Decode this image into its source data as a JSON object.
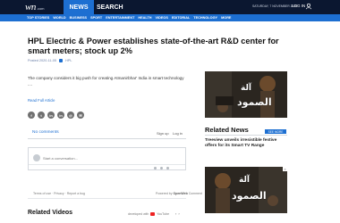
{
  "header": {
    "logo_main": "wn",
    "logo_sub": ".com",
    "tab_news": "NEWS",
    "tab_search": "SEARCH",
    "datetime": "SATURDAY, 7 NOVEMBER 2020",
    "login": "LOG IN"
  },
  "nav": {
    "items": [
      "TOP STORIES",
      "WORLD",
      "BUSINESS",
      "SPORT",
      "ENTERTAINMENT",
      "HEALTH",
      "VIDEOS",
      "EDITORIAL",
      "TECHNOLOGY",
      "MORE"
    ]
  },
  "article": {
    "headline": "HPL Electric & Power establishes state-of-the-art R&D center for smart meters; stock up 2%",
    "byline_time": "Posted 2020-11-05",
    "byline_source": "HPL",
    "summary": "The company considers it big push for creating Atmanirbhar' India in smart technology ....",
    "read_full": "Read Full Article",
    "share_buttons": [
      "f",
      "t",
      "in",
      "in",
      "@",
      "✉"
    ]
  },
  "comments": {
    "title": "No comments",
    "signup": "Sign up",
    "login": "Log in",
    "placeholder": "Start a conversation...",
    "terms": "Terms of use  ·  Privacy  ·  Report a bug",
    "powered_by": "Powered by",
    "powered_brand": "OpenWeb",
    "powered_suffix": "Comment"
  },
  "related_videos": {
    "title": "Related Videos",
    "developed_with": "developed with",
    "youtube": "YouTube"
  },
  "related_news": {
    "title": "Related News",
    "see_more": "SEE MORE",
    "items": [
      "Treeview unveils irresistible festive offers for its Smart TV Range"
    ]
  },
  "thumbnails": {
    "top_text_a": "آلة",
    "top_text_b": "الصمود"
  }
}
